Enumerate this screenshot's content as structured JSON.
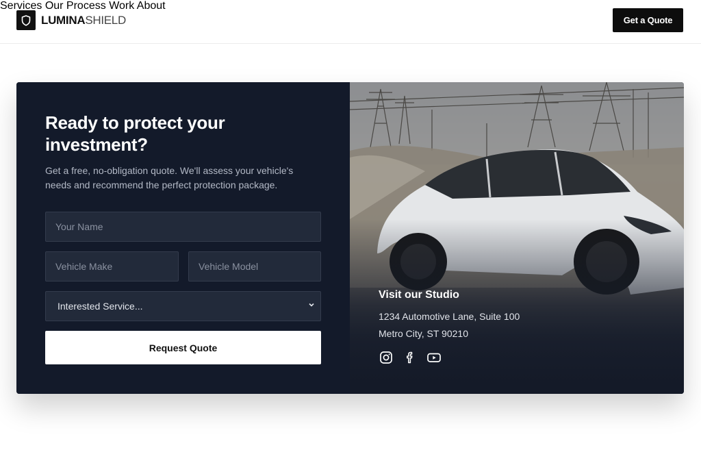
{
  "header": {
    "logo_bold": "LUMINA",
    "logo_light": "SHIELD",
    "logo_icon": "shield-icon",
    "nav": [
      "Services",
      "Our Process",
      "Work",
      "About"
    ],
    "cta": "Get a Quote"
  },
  "quote": {
    "headline": "Ready to protect your investment?",
    "subtext": "Get a free, no-obligation quote. We'll assess your vehicle's needs and recommend the perfect protection package.",
    "name_placeholder": "Your Name",
    "make_placeholder": "Vehicle Make",
    "model_placeholder": "Vehicle Model",
    "service_selected": "Interested Service...",
    "submit": "Request Quote"
  },
  "studio": {
    "title": "Visit our Studio",
    "address_line1": "1234 Automotive Lane, Suite 100",
    "address_line2": "Metro City, ST 90210",
    "social_icons": [
      "instagram-icon",
      "facebook-icon",
      "youtube-icon"
    ]
  },
  "colors": {
    "panel": "#131a2a",
    "field": "#222a3a",
    "accent": "#0d0d0d"
  }
}
